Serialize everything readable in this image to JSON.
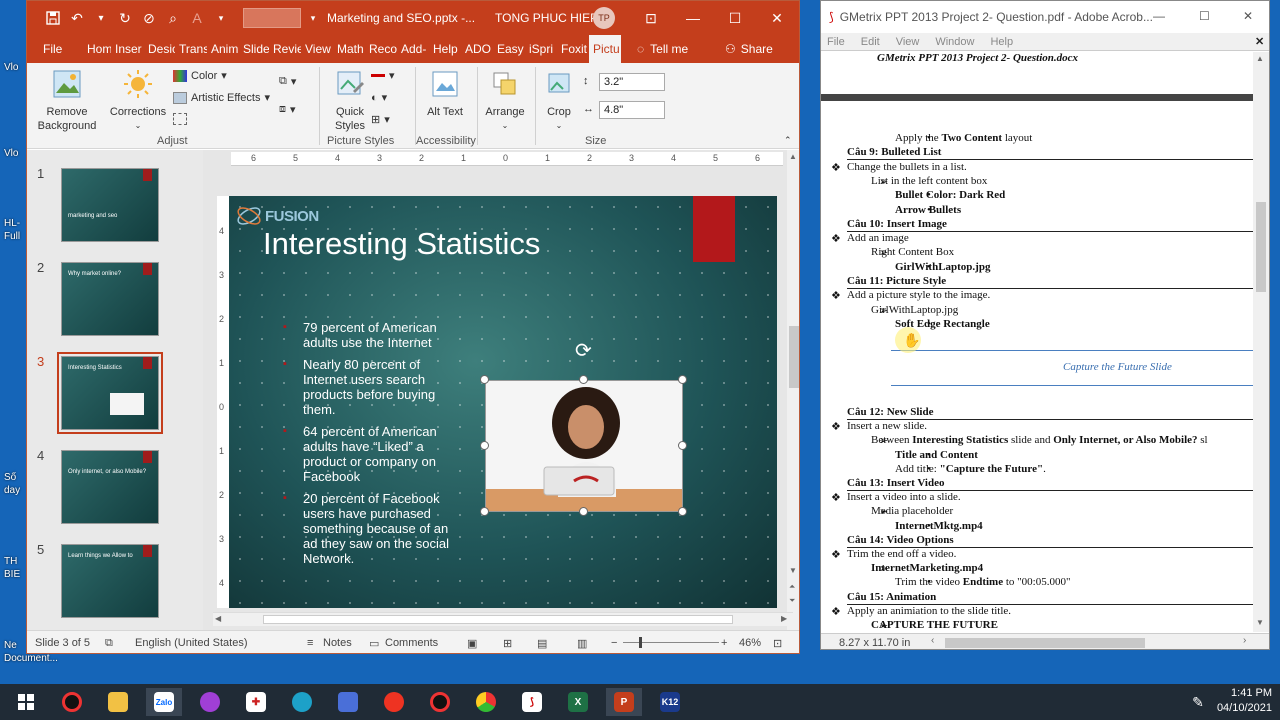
{
  "desktop": {
    "labels": [
      "Vlo",
      "Vlo",
      "HL-",
      "Full",
      "Số",
      "day",
      "TH",
      "BIE",
      "Ne",
      "Document..."
    ]
  },
  "ppt": {
    "file_name": "Marketing and SEO.pptx -...",
    "user": "TONG PHUC HIEP",
    "user_initials": "TP",
    "tabs": [
      "File",
      "Hom",
      "Inser",
      "Desic",
      "Trans",
      "Anim",
      "Slide",
      "Revie",
      "View",
      "Math",
      "Reco",
      "Add-",
      "Help",
      "ADO",
      "Easy",
      "iSpri",
      "Foxit",
      "Pictu"
    ],
    "active_tab": "Pictu",
    "tell_me": "Tell me",
    "share": "Share",
    "ribbon": {
      "remove_background": "Remove Background",
      "corrections": "Corrections",
      "color": "Color",
      "artistic_effects": "Artistic Effects",
      "quick_styles": "Quick Styles",
      "alt_text": "Alt Text",
      "arrange": "Arrange",
      "crop": "Crop",
      "height": "3.2\"",
      "width": "4.8\"",
      "groups": [
        "Adjust",
        "Picture Styles",
        "Accessibility",
        "Size"
      ]
    },
    "ruler_marks": [
      "6",
      "5",
      "4",
      "3",
      "2",
      "1",
      "0",
      "1",
      "2",
      "3",
      "4",
      "5",
      "6"
    ],
    "vruler_marks": [
      "4",
      "3",
      "2",
      "1",
      "0",
      "1",
      "2",
      "3",
      "4"
    ],
    "thumbnails": [
      {
        "num": "1",
        "title": "marketing and seo"
      },
      {
        "num": "2",
        "title": "Why market online?"
      },
      {
        "num": "3",
        "title": "Interesting Statistics"
      },
      {
        "num": "4",
        "title": "Only internet, or also Mobile?"
      },
      {
        "num": "5",
        "title": "Learn things we Allow to"
      }
    ],
    "selected_slide": "3",
    "slide": {
      "logo": "FUSION",
      "title": "Interesting Statistics",
      "bullets": [
        "79 percent of American adults use the Internet",
        "Nearly 80 percent of Internet users search products before buying them.",
        "64 percent of American adults have “Liked” a product or company on Facebook",
        "20 percent of Facebook users have purchased something because of an ad they saw on the social Network."
      ]
    },
    "status": {
      "slide_info": "Slide 3 of 5",
      "language": "English (United States)",
      "notes": "Notes",
      "comments": "Comments",
      "zoom": "46%"
    }
  },
  "acrobat": {
    "title": "GMetrix PPT 2013 Project 2- Question.pdf - Adobe Acrob...",
    "menu": [
      "File",
      "Edit",
      "View",
      "Window",
      "Help"
    ],
    "doc_header": "GMetrix PPT 2013 Project 2- Question.docx",
    "lines": [
      {
        "indent": 3,
        "bullet": "•",
        "parts": [
          [
            "Apply the ",
            false
          ],
          [
            "Two Content",
            true
          ],
          [
            " layout",
            false
          ]
        ]
      },
      {
        "indent": 0,
        "heading": true,
        "parts": [
          [
            "Câu 9:    Bulleted List",
            true
          ]
        ]
      },
      {
        "indent": 1,
        "bullet": "❖",
        "parts": [
          [
            "Change the bullets in a list.",
            false
          ]
        ]
      },
      {
        "indent": 2,
        "bullet": "➢",
        "parts": [
          [
            "List in the left content box",
            false
          ]
        ]
      },
      {
        "indent": 3,
        "bullet": "•",
        "parts": [
          [
            "Bullet Color: Dark Red",
            true
          ]
        ]
      },
      {
        "indent": 3,
        "bullet": "•",
        "parts": [
          [
            "Arrow Bullets",
            true
          ]
        ]
      },
      {
        "indent": 0,
        "heading": true,
        "parts": [
          [
            "Câu 10:  Insert Image",
            true
          ]
        ]
      },
      {
        "indent": 1,
        "bullet": "❖",
        "parts": [
          [
            "Add an image",
            false
          ]
        ]
      },
      {
        "indent": 2,
        "bullet": "➢",
        "parts": [
          [
            "Right Content Box",
            false
          ]
        ]
      },
      {
        "indent": 3,
        "bullet": "•",
        "parts": [
          [
            "GirlWithLaptop.jpg",
            true
          ]
        ]
      },
      {
        "indent": 0,
        "heading": true,
        "parts": [
          [
            "Câu 11:  Picture Style",
            true
          ]
        ]
      },
      {
        "indent": 1,
        "bullet": "❖",
        "parts": [
          [
            "Add a picture style to the image.",
            false
          ]
        ]
      },
      {
        "indent": 2,
        "bullet": "➢",
        "parts": [
          [
            "GirlWithLaptop.jpg",
            false
          ]
        ]
      },
      {
        "indent": 3,
        "bullet": "•",
        "parts": [
          [
            "Soft Edge Rectangle",
            true
          ]
        ]
      }
    ],
    "capture_slide": "Capture the Future Slide",
    "lines2": [
      {
        "indent": 0,
        "heading": true,
        "parts": [
          [
            "Câu 12:  New Slide",
            true
          ]
        ]
      },
      {
        "indent": 1,
        "bullet": "❖",
        "parts": [
          [
            "Insert a new slide.",
            false
          ]
        ]
      },
      {
        "indent": 2,
        "bullet": "➢",
        "parts": [
          [
            "Between ",
            false
          ],
          [
            "Interesting Statistics",
            true
          ],
          [
            " slide and ",
            false
          ],
          [
            "Only Internet, or Also Mobile?",
            true
          ],
          [
            " sl",
            false
          ]
        ]
      },
      {
        "indent": 3,
        "bullet": "•",
        "parts": [
          [
            "Title and Content",
            true
          ]
        ]
      },
      {
        "indent": 3,
        "bullet": "•",
        "parts": [
          [
            "Add title: ",
            false
          ],
          [
            "\"Capture the Future\"",
            true
          ],
          [
            ".",
            false
          ]
        ]
      },
      {
        "indent": 0,
        "heading": true,
        "parts": [
          [
            "Câu 13:  Insert Video",
            true
          ]
        ]
      },
      {
        "indent": 1,
        "bullet": "❖",
        "parts": [
          [
            "Insert a video into a slide.",
            false
          ]
        ]
      },
      {
        "indent": 2,
        "bullet": "➢",
        "parts": [
          [
            "Media placeholder",
            false
          ]
        ]
      },
      {
        "indent": 3,
        "bullet": "•",
        "parts": [
          [
            "InternetMktg.mp4",
            true
          ]
        ]
      },
      {
        "indent": 0,
        "heading": true,
        "parts": [
          [
            "Câu 14:  Video Options",
            true
          ]
        ]
      },
      {
        "indent": 1,
        "bullet": "❖",
        "parts": [
          [
            "Trim the end off a video.",
            false
          ]
        ]
      },
      {
        "indent": 2,
        "bullet": "➢",
        "parts": [
          [
            "InternetMarketing.mp4",
            true
          ]
        ]
      },
      {
        "indent": 3,
        "bullet": "•",
        "parts": [
          [
            "Trim the video ",
            false
          ],
          [
            "Endtime",
            true
          ],
          [
            " to \"00:05.000\"",
            false
          ]
        ]
      },
      {
        "indent": 0,
        "heading": true,
        "parts": [
          [
            "Câu 15:  Animation",
            true
          ]
        ]
      },
      {
        "indent": 1,
        "bullet": "❖",
        "parts": [
          [
            "Apply an animiation to the slide title.",
            false
          ]
        ]
      },
      {
        "indent": 2,
        "bullet": "➢",
        "parts": [
          [
            "CAPTURE THE FUTURE",
            true
          ]
        ]
      }
    ],
    "page_size": "8.27 x 11.70 in"
  },
  "taskbar": {
    "time": "1:41 PM",
    "date": "04/10/2021",
    "apps": [
      "start-icon",
      "record-icon",
      "explorer-icon",
      "zalo-icon",
      "chat-icon",
      "puzzle-icon",
      "edge-icon",
      "floppy-icon",
      "opera-icon",
      "obs-icon",
      "chrome-icon",
      "acrobat-icon",
      "excel-icon",
      "powerpoint-icon",
      "k12-icon"
    ]
  },
  "colors": {
    "ppt_accent": "#c43e1c",
    "desktop_bg": "#1565b8",
    "slide_bg": "#1f5457",
    "slide_red": "#b3181b"
  }
}
